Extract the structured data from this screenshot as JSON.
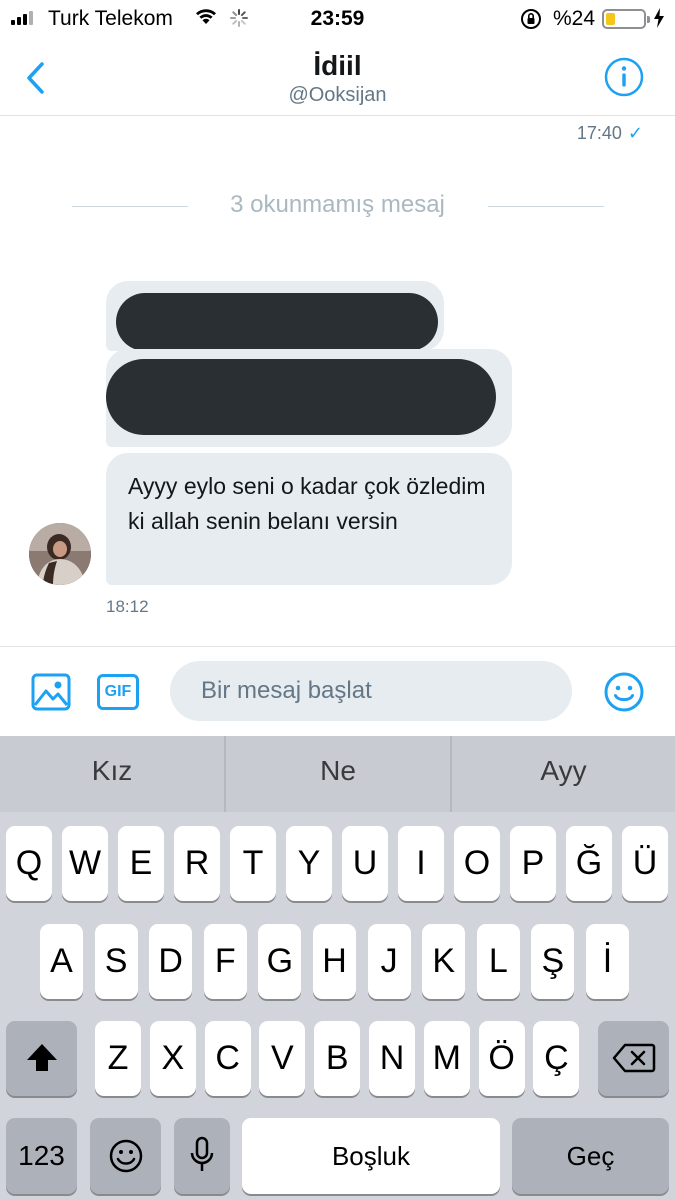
{
  "status_bar": {
    "carrier": "Turk Telekom",
    "time": "23:59",
    "battery_text": "%24",
    "battery_level": 0.24,
    "battery_color": "#f5c518",
    "icons": [
      "signal-icon",
      "wifi-icon",
      "activity-spinner-icon",
      "orientation-lock-icon",
      "battery-icon",
      "charging-bolt-icon"
    ]
  },
  "header": {
    "name": "İdiil",
    "handle": "@Ooksijan",
    "back_icon": "chevron-left-icon",
    "info_icon": "info-icon"
  },
  "conversation": {
    "sent_time": "17:40",
    "sent_status_icon": "checkmark-icon",
    "unread_divider": "3 okunmamış mesaj",
    "received_message": "Ayyy eylo seni o kadar çok özledim ki allah senin belanı versin",
    "received_time": "18:12",
    "redacted_messages": 2
  },
  "composer": {
    "placeholder": "Bir mesaj başlat",
    "gif_label": "GIF",
    "icons": [
      "image-icon",
      "gif-icon",
      "emoji-icon"
    ]
  },
  "keyboard": {
    "suggestions": [
      "Kız",
      "Ne",
      "Ayy"
    ],
    "row1": [
      "Q",
      "W",
      "E",
      "R",
      "T",
      "Y",
      "U",
      "I",
      "O",
      "P",
      "Ğ",
      "Ü"
    ],
    "row2": [
      "A",
      "S",
      "D",
      "F",
      "G",
      "H",
      "J",
      "K",
      "L",
      "Ş",
      "İ"
    ],
    "row3": [
      "Z",
      "X",
      "C",
      "V",
      "B",
      "N",
      "M",
      "Ö",
      "Ç"
    ],
    "numbers_label": "123",
    "space_label": "Boşluk",
    "return_label": "Geç",
    "icons": [
      "shift-icon",
      "backspace-icon",
      "emoji-keyboard-icon",
      "microphone-icon"
    ]
  },
  "colors": {
    "accent": "#1da1f2",
    "bubble": "#e6ecf0",
    "redaction": "#292f33",
    "keyboard_bg": "#d1d4db"
  }
}
